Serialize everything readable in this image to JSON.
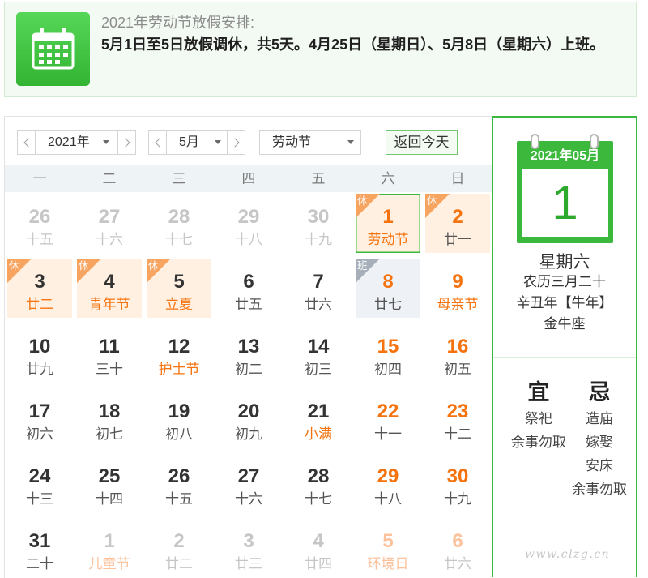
{
  "notice": {
    "icon": "calendar-icon",
    "title": "2021年劳动节放假安排:",
    "text": "5月1日至5日放假调休，共5天。4月25日（星期日）、5月8日（星期六）上班。"
  },
  "controls": {
    "prev_icon": "chevron-left-icon",
    "next_icon": "chevron-right-icon",
    "dropdown_icon": "caret-down-icon",
    "year": "2021年",
    "month": "5月",
    "holiday": "劳动节",
    "today_button": "返回今天"
  },
  "weekdays": [
    "一",
    "二",
    "三",
    "四",
    "五",
    "六",
    "日"
  ],
  "days": [
    {
      "day": "26",
      "lunar": "十五",
      "other": true
    },
    {
      "day": "27",
      "lunar": "十六",
      "other": true
    },
    {
      "day": "28",
      "lunar": "十七",
      "other": true
    },
    {
      "day": "29",
      "lunar": "十八",
      "other": true
    },
    {
      "day": "30",
      "lunar": "十九",
      "other": true
    },
    {
      "day": "1",
      "lunar": "劳动节",
      "weekend": true,
      "lunar_accent": true,
      "tag": "休",
      "selected": true
    },
    {
      "day": "2",
      "lunar": "廿一",
      "weekend": true,
      "tag": "休"
    },
    {
      "day": "3",
      "lunar": "廿二",
      "lunar_accent": true,
      "tag": "休"
    },
    {
      "day": "4",
      "lunar": "青年节",
      "lunar_accent": true,
      "tag": "休"
    },
    {
      "day": "5",
      "lunar": "立夏",
      "lunar_accent": true,
      "tag": "休"
    },
    {
      "day": "6",
      "lunar": "廿五"
    },
    {
      "day": "7",
      "lunar": "廿六"
    },
    {
      "day": "8",
      "lunar": "廿七",
      "weekend": true,
      "tag": "班"
    },
    {
      "day": "9",
      "lunar": "母亲节",
      "weekend": true,
      "lunar_accent": true
    },
    {
      "day": "10",
      "lunar": "廿九"
    },
    {
      "day": "11",
      "lunar": "三十"
    },
    {
      "day": "12",
      "lunar": "护士节",
      "lunar_accent": true
    },
    {
      "day": "13",
      "lunar": "初二"
    },
    {
      "day": "14",
      "lunar": "初三"
    },
    {
      "day": "15",
      "lunar": "初四",
      "weekend": true
    },
    {
      "day": "16",
      "lunar": "初五",
      "weekend": true
    },
    {
      "day": "17",
      "lunar": "初六"
    },
    {
      "day": "18",
      "lunar": "初七"
    },
    {
      "day": "19",
      "lunar": "初八"
    },
    {
      "day": "20",
      "lunar": "初九"
    },
    {
      "day": "21",
      "lunar": "小满",
      "lunar_accent": true
    },
    {
      "day": "22",
      "lunar": "十一",
      "weekend": true
    },
    {
      "day": "23",
      "lunar": "十二",
      "weekend": true
    },
    {
      "day": "24",
      "lunar": "十三"
    },
    {
      "day": "25",
      "lunar": "十四"
    },
    {
      "day": "26",
      "lunar": "十五"
    },
    {
      "day": "27",
      "lunar": "十六"
    },
    {
      "day": "28",
      "lunar": "十七"
    },
    {
      "day": "29",
      "lunar": "十八",
      "weekend": true
    },
    {
      "day": "30",
      "lunar": "十九",
      "weekend": true
    },
    {
      "day": "31",
      "lunar": "二十"
    },
    {
      "day": "1",
      "lunar": "儿童节",
      "other": true,
      "lunar_accent": true
    },
    {
      "day": "2",
      "lunar": "廿二",
      "other": true
    },
    {
      "day": "3",
      "lunar": "廿三",
      "other": true
    },
    {
      "day": "4",
      "lunar": "廿四",
      "other": true
    },
    {
      "day": "5",
      "lunar": "环境日",
      "other": true,
      "weekend": true,
      "lunar_accent": true
    },
    {
      "day": "6",
      "lunar": "廿六",
      "other": true,
      "weekend": true
    }
  ],
  "panel": {
    "card_header": "2021年05月",
    "card_day": "1",
    "weekday": "星期六",
    "lunar_date": "农历三月二十",
    "ganzhi": "辛丑年【牛年】",
    "zodiac": "金牛座",
    "yi_label": "宜",
    "ji_label": "忌",
    "yi": [
      "祭祀",
      "余事勿取"
    ],
    "ji": [
      "造庙",
      "嫁娶",
      "安床",
      "余事勿取"
    ]
  },
  "colors": {
    "green": "#3cb93c",
    "orange": "#f5730f",
    "rest_bg": "#fff0e2",
    "work_bg": "#eef1f5",
    "rest_tag": "#f7a460",
    "work_tag": "#a7b0ba"
  },
  "watermark": "www.clzg.cn"
}
